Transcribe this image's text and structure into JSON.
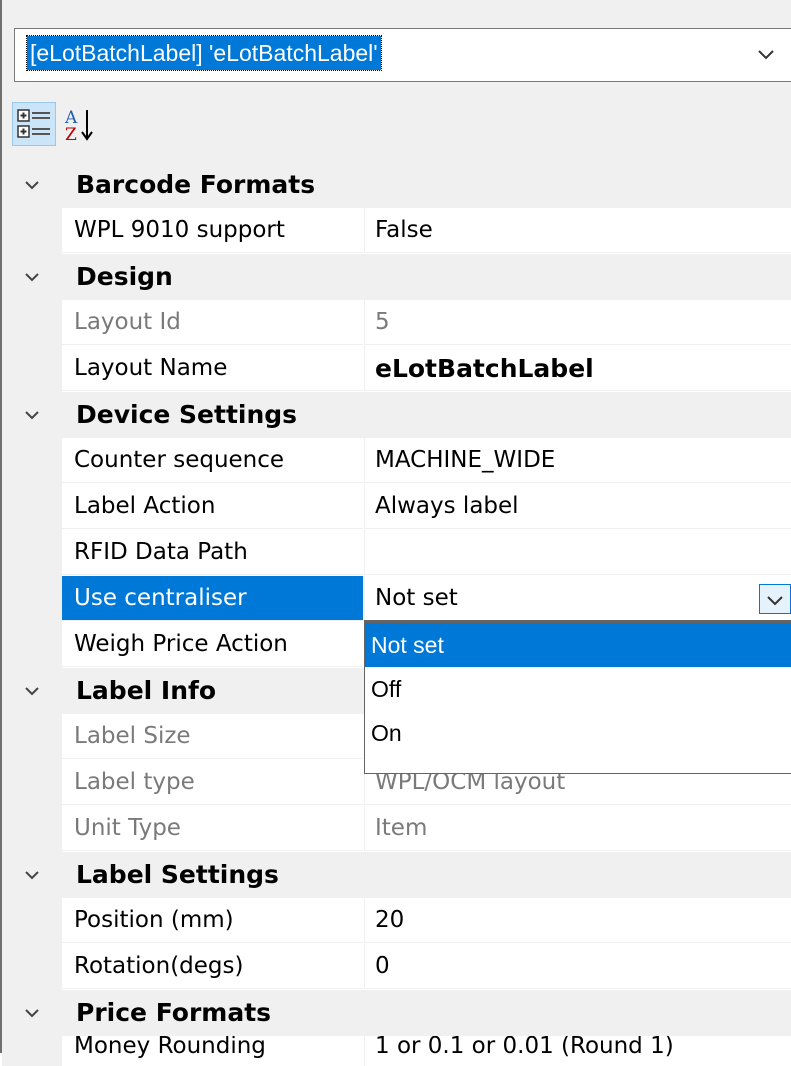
{
  "object_picker": {
    "value": "[eLotBatchLabel] 'eLotBatchLabel'",
    "chevron_icon": "chevron-down-icon"
  },
  "toolbar": {
    "categorized_icon": "categorized-view-icon",
    "alphabetical_icon": "sort-alphabetical-icon"
  },
  "grid": {
    "categories": [
      {
        "name": "Barcode Formats",
        "properties": [
          {
            "name": "WPL 9010 support",
            "value": "False"
          }
        ]
      },
      {
        "name": "Design",
        "properties": [
          {
            "name": "Layout Id",
            "value": "5"
          },
          {
            "name": "Layout Name",
            "value": "eLotBatchLabel"
          }
        ]
      },
      {
        "name": "Device Settings",
        "properties": [
          {
            "name": "Counter sequence",
            "value": "MACHINE_WIDE"
          },
          {
            "name": "Label Action",
            "value": "Always label"
          },
          {
            "name": "RFID Data Path",
            "value": ""
          },
          {
            "name": "Use centraliser",
            "value": "Not set"
          },
          {
            "name": "Weigh Price Action",
            "value": ""
          }
        ]
      },
      {
        "name": "Label Info",
        "properties": [
          {
            "name": "Label Size",
            "value": ""
          },
          {
            "name": "Label type",
            "value": "WPL/OCM layout"
          },
          {
            "name": "Unit Type",
            "value": "Item"
          }
        ]
      },
      {
        "name": "Label Settings",
        "properties": [
          {
            "name": "Position (mm)",
            "value": "20"
          },
          {
            "name": "Rotation(degs)",
            "value": "0"
          }
        ]
      },
      {
        "name": "Price Formats",
        "properties": [
          {
            "name": "Money Rounding",
            "value": "1 or 0.1 or 0.01 (Round 1)"
          }
        ]
      }
    ]
  },
  "dropdown": {
    "options": [
      "Not set",
      "Off",
      "On"
    ],
    "selected": "Not set"
  },
  "colors": {
    "selection": "#0078d7",
    "gutter": "#f0f0f0",
    "readonly_text": "#7a7a7a"
  }
}
